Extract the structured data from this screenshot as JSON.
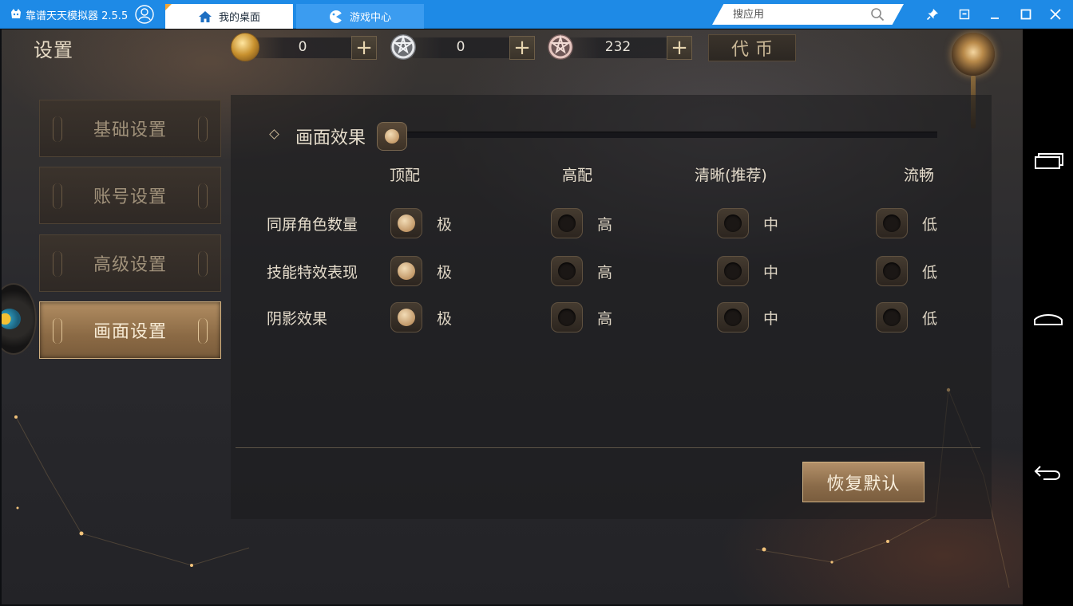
{
  "emulator": {
    "title": "靠谱天天模拟器 2.5.5",
    "tabs": [
      {
        "label": "我的桌面",
        "icon": "home-icon",
        "active": true
      },
      {
        "label": "游戏中心",
        "icon": "gamepad-icon",
        "active": false
      }
    ],
    "search": {
      "placeholder": "搜应用",
      "value": ""
    },
    "window_controls": [
      "pin-icon",
      "restore-icon",
      "minimize-icon",
      "maximize-icon",
      "close-icon"
    ],
    "colors": {
      "titlebar": "#1e8ae6",
      "active_tab": "#ffffff"
    }
  },
  "game": {
    "page_title": "设置",
    "currencies": [
      {
        "icon": "gold-coin-icon",
        "value": "0"
      },
      {
        "icon": "silver-coin-icon",
        "value": "0"
      },
      {
        "icon": "copper-coin-icon",
        "value": "232"
      }
    ],
    "plus_label": "+",
    "token_label": "代币",
    "nav": [
      {
        "label": "基础设置",
        "active": false
      },
      {
        "label": "账号设置",
        "active": false
      },
      {
        "label": "高级设置",
        "active": false
      },
      {
        "label": "画面设置",
        "active": true
      }
    ],
    "section_title": "画面效果",
    "slider_level": 0,
    "columns": [
      "顶配",
      "高配",
      "清晰(推荐)",
      "流畅"
    ],
    "option_labels": [
      "极",
      "高",
      "中",
      "低"
    ],
    "rows": [
      {
        "label": "同屏角色数量",
        "selected": 0
      },
      {
        "label": "技能特效表现",
        "selected": 0
      },
      {
        "label": "阴影效果",
        "selected": 0
      }
    ],
    "restore_label": "恢复默认",
    "colors": {
      "accent": "#b39069",
      "text": "#e5dccb"
    }
  },
  "android_nav": [
    "recent-apps-icon",
    "home-icon",
    "back-icon"
  ]
}
